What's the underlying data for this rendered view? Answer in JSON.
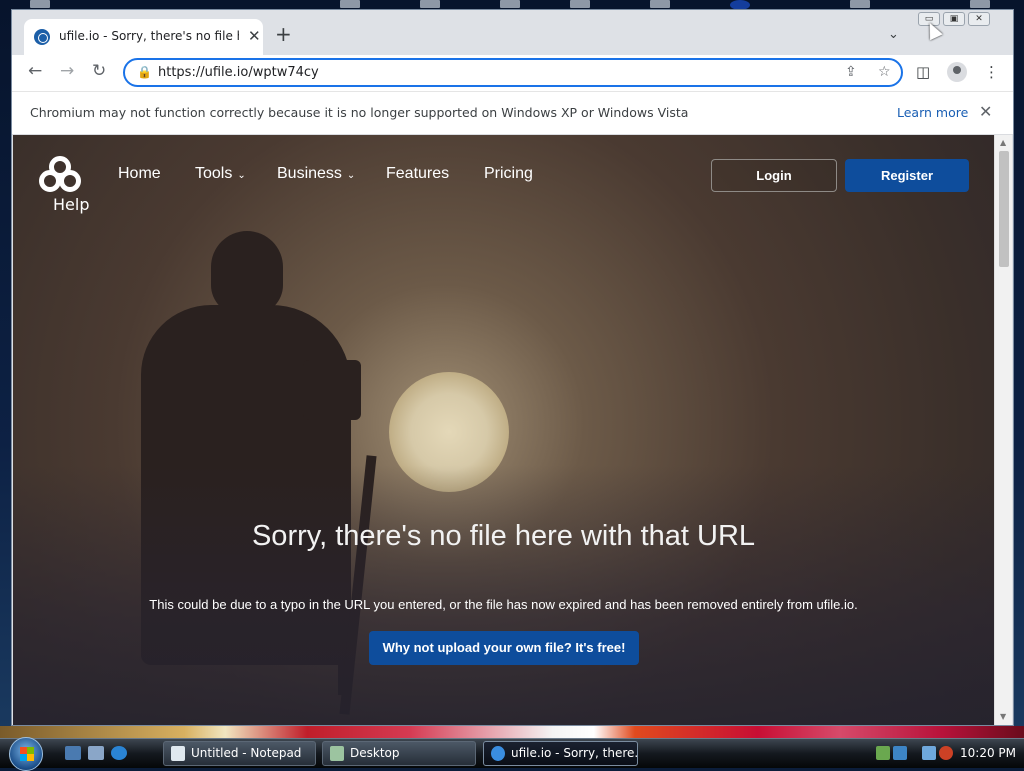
{
  "browser": {
    "tab": {
      "title": "ufile.io - Sorry, there's no file here with that URL",
      "close": "✕"
    },
    "new_tab": "+",
    "tab_search": "⌄",
    "window_buttons": {
      "minimize": "▭",
      "restore": "▣",
      "close": "✕"
    },
    "nav": {
      "back": "←",
      "forward": "→",
      "reload": "↻"
    },
    "address": {
      "url": "https://ufile.io/wptw74cy",
      "lock": "🔒"
    },
    "toolbar_icons": {
      "share": "⇪",
      "bookmark": "☆",
      "side_panel": "◫",
      "menu": "⋮"
    },
    "infobar": {
      "message": "Chromium may not function correctly because it is no longer supported on Windows XP or Windows Vista",
      "link": "Learn more",
      "close": "✕"
    }
  },
  "page": {
    "logo_label": "Help",
    "nav": [
      {
        "label": "Home",
        "dropdown": false
      },
      {
        "label": "Tools",
        "dropdown": true
      },
      {
        "label": "Business",
        "dropdown": true
      },
      {
        "label": "Features",
        "dropdown": false
      },
      {
        "label": "Pricing",
        "dropdown": false
      }
    ],
    "chevron": "⌄",
    "login": "Login",
    "register": "Register",
    "headline": "Sorry, there's no file here with that URL",
    "subtext": "This could be due to a typo in the URL you entered, or the file has now expired and has been removed entirely from ufile.io.",
    "cta": "Why not upload your own file? It's free!"
  },
  "scrollbar": {
    "up": "▲",
    "down": "▼"
  },
  "taskbar": {
    "tasks": [
      {
        "label": "Untitled - Notepad",
        "active": false
      },
      {
        "label": "Desktop",
        "active": false
      },
      {
        "label": "ufile.io - Sorry, there...",
        "active": true
      }
    ],
    "clock": "10:20 PM"
  },
  "colors": {
    "accent": "#0e4d9c",
    "omnibox_focus": "#1a73e8",
    "link": "#1a5fb4"
  }
}
